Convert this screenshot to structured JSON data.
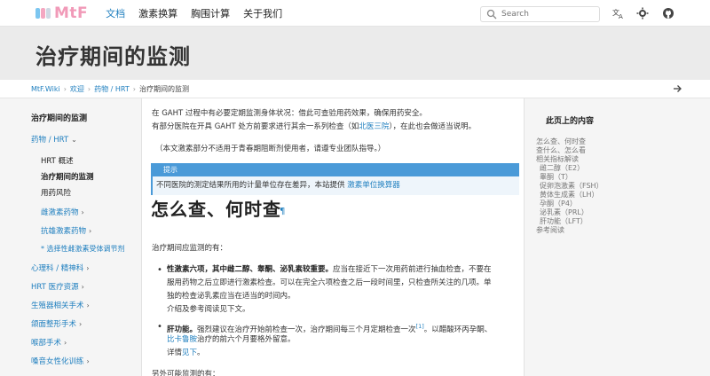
{
  "nav": {
    "logo_text": "MtF",
    "links": [
      "文档",
      "激素换算",
      "胸围计算",
      "关于我们"
    ],
    "search_placeholder": "Search"
  },
  "hero": {
    "title": "治疗期间的监测"
  },
  "breadcrumb": {
    "items": [
      "MtF.Wiki",
      "欢迎",
      "药物 / HRT"
    ],
    "current": "治疗期间的监测"
  },
  "sidebar": {
    "section_title": "治疗期间的监测",
    "group": "药物 / HRT",
    "sub_items": [
      "HRT 概述",
      "治疗期间的监测",
      "用药风险"
    ],
    "links": [
      "雌激素药物",
      "抗雄激素药物",
      "* 选择性雌激素受体调节剂",
      "心理科 / 精神科",
      "HRT 医疗资源",
      "生殖器相关手术",
      "颌面整形手术",
      "喉部手术",
      "嗓音女性化训练"
    ]
  },
  "content": {
    "intro1": "在 GAHT 过程中有必要定期监测身体状况：借此可查验用药效果，确保用药安全。",
    "intro2_a": "有部分医院在开具 GAHT 处方前要求进行其余一系列检查（如",
    "intro2_link": "北医三院",
    "intro2_b": "），在此也会做适当说明。",
    "note": "（本文激素部分不适用于青春期阻断剂使用者，请遵专业团队指导。）",
    "tip_title": "提示",
    "tip_a": "不同医院的测定结果所用的计量单位存在差异，本站提供 ",
    "tip_link": "激素单位换算器",
    "heading": "怎么查、何时查",
    "anchor": "¶",
    "monitor_intro": "治疗期间应监测的有：",
    "b1_bold": "性激素六项，其中雌二醇、睾酮、泌乳素较重要。",
    "b1_a": "应当在接近下一次用药前进行抽血检查，不要在",
    "b1_b": "服用药物之后立即进行激素检查。可以在完全六项检查之后一段时间里，只检查所关注的几项。单",
    "b1_c": "独的检查泌乳素应当在适当的时间内。",
    "b1_d": "介绍及参考阅读见下文。",
    "b2_bold": "肝功能。",
    "b2_a": "强烈建议在治疗开始前检查一次，治疗期间每三个月定期检查一次",
    "b2_sup": "[1]",
    "b2_b": "。以醋酸环丙孕酮、",
    "b2_link": "比卡鲁胺",
    "b2_c": "治疗的前六个月要格外留意。",
    "b2_d_a": "详情",
    "b2_d_link": "见下",
    "b2_d_b": "。",
    "tail": "另外可能监测的有："
  },
  "toc": {
    "title": "此页上的内容",
    "items": [
      "怎么查、何时查",
      "查什么、怎么看",
      "相关指标解读",
      "雌二醇（E2）",
      "睾酮（T）",
      "促卵泡激素（FSH）",
      "黄体生成素（LH）",
      "孕酮（P4）",
      "泌乳素（PRL）",
      "肝功能（LFT）",
      "参考阅读"
    ]
  }
}
